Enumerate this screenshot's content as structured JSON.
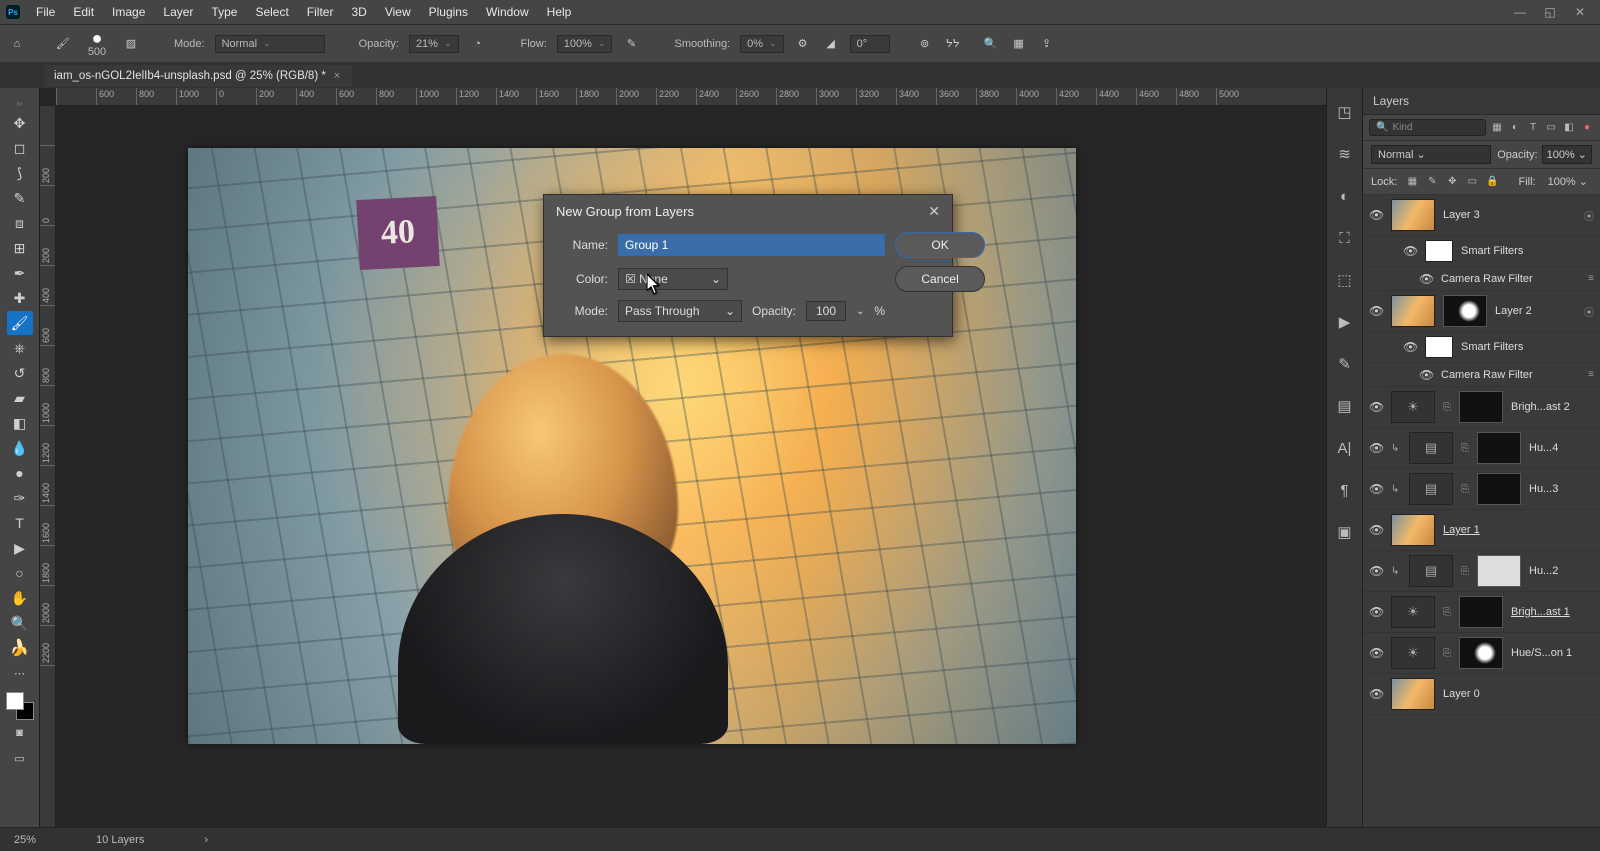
{
  "menu": [
    "File",
    "Edit",
    "Image",
    "Layer",
    "Type",
    "Select",
    "Filter",
    "3D",
    "View",
    "Plugins",
    "Window",
    "Help"
  ],
  "optbar": {
    "brush_size": "500",
    "mode_label": "Mode:",
    "mode_value": "Normal",
    "opacity_label": "Opacity:",
    "opacity_value": "21%",
    "flow_label": "Flow:",
    "flow_value": "100%",
    "smoothing_label": "Smoothing:",
    "smoothing_value": "0%",
    "angle_value": "0°"
  },
  "tab": {
    "title": "iam_os-nGOL2IelIb4-unsplash.psd @ 25% (RGB/8) *"
  },
  "hruler": [
    "",
    "600",
    "800",
    "1000",
    "0",
    "200",
    "400",
    "600",
    "800",
    "1000",
    "1200",
    "1400",
    "1600",
    "1800",
    "2000",
    "2200",
    "2400",
    "2600",
    "2800",
    "3000",
    "3200",
    "3400",
    "3600",
    "3800",
    "4000",
    "4200",
    "4400",
    "4600",
    "4800",
    "5000"
  ],
  "vruler": [
    "",
    "200",
    "0",
    "200",
    "400",
    "600",
    "800",
    "1000",
    "1200",
    "1400",
    "1600",
    "1800",
    "2000",
    "2200"
  ],
  "sign": "40",
  "dialog": {
    "title": "New Group from Layers",
    "name_label": "Name:",
    "name_value": "Group 1",
    "color_label": "Color:",
    "color_value": "None",
    "mode_label": "Mode:",
    "mode_value": "Pass Through",
    "opacity_label": "Opacity:",
    "opacity_value": "100",
    "opacity_suffix": "%",
    "ok": "OK",
    "cancel": "Cancel"
  },
  "layers_panel": {
    "title": "Layers",
    "search_placeholder": "Kind",
    "blend_mode": "Normal",
    "opacity_label": "Opacity:",
    "opacity_value": "100%",
    "lock_label": "Lock:",
    "fill_label": "Fill:",
    "fill_value": "100%",
    "items": [
      {
        "name": "Layer 3",
        "type": "img",
        "smart": true
      },
      {
        "name": "Smart Filters",
        "type": "sf"
      },
      {
        "name": "Camera Raw Filter",
        "type": "sff"
      },
      {
        "name": "Layer 2",
        "type": "img_mask",
        "smart": true
      },
      {
        "name": "Smart Filters",
        "type": "sf"
      },
      {
        "name": "Camera Raw Filter",
        "type": "sff"
      },
      {
        "name": "Brigh...ast 2",
        "type": "adj_sun"
      },
      {
        "name": "Hu...4",
        "type": "adj_clip"
      },
      {
        "name": "Hu...3",
        "type": "adj_clip"
      },
      {
        "name": "Layer 1",
        "type": "img_ul"
      },
      {
        "name": "Hu...2",
        "type": "adj_clip_light"
      },
      {
        "name": "Brigh...ast 1",
        "type": "adj_sun_ul"
      },
      {
        "name": "Hue/S...on 1",
        "type": "adj_mask"
      },
      {
        "name": "Layer 0",
        "type": "img"
      }
    ]
  },
  "status": {
    "zoom": "25%",
    "info": "10 Layers"
  }
}
